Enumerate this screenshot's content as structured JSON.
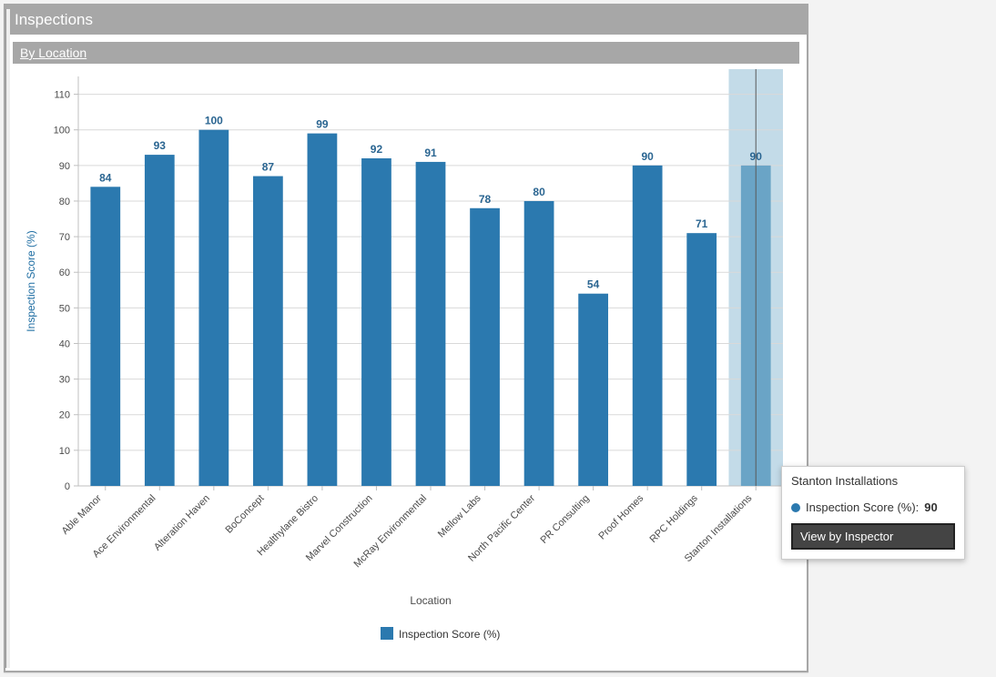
{
  "panel_title": "Inspections",
  "sub_header": "By Location",
  "chart_data": {
    "type": "bar",
    "title": "",
    "xlabel": "Location",
    "ylabel": "Inspection Score (%)",
    "categories": [
      "Able Manor",
      "Ace Environmental",
      "Alteration Haven",
      "BoConcept",
      "Healthylane Bistro",
      "Marvel Construction",
      "McRay Environmental",
      "Mellow Labs",
      "North Pacific Center",
      "PR Consulting",
      "Proof Homes",
      "RPC Holdings",
      "Stanton Installations"
    ],
    "values": [
      84,
      93,
      100,
      87,
      99,
      92,
      91,
      78,
      80,
      54,
      90,
      71,
      90
    ],
    "ylim": [
      0,
      115
    ],
    "y_ticks": [
      0,
      10,
      20,
      30,
      40,
      50,
      60,
      70,
      80,
      90,
      100,
      110
    ],
    "legend": "Inspection Score (%)",
    "highlight_index": 12
  },
  "tooltip": {
    "title": "Stanton Installations",
    "series_label": "Inspection Score (%):",
    "value": "90",
    "button_label": "View by Inspector"
  },
  "colors": {
    "bar": "#2b79af",
    "bar_label": "#2a6591",
    "highlight_band": "#c3dbe8",
    "highlight_bar": "#6aa4c6",
    "grid": "#d9d9d9",
    "axis": "#bfbfbf"
  }
}
